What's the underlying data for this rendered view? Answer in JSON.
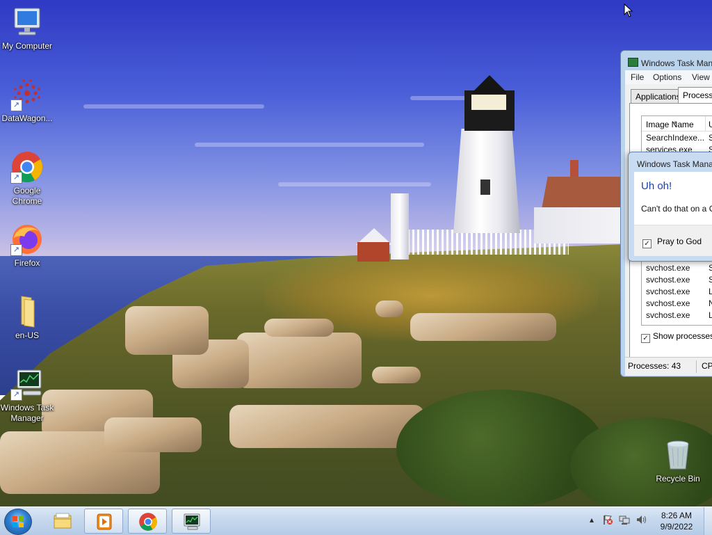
{
  "desktop": {
    "icons": [
      {
        "label": "My Computer",
        "icon": "computer-icon"
      },
      {
        "label": "DataWagon...",
        "icon": "datawagon-icon"
      },
      {
        "label": "Google Chrome",
        "icon": "chrome-icon"
      },
      {
        "label": "Firefox",
        "icon": "firefox-icon"
      },
      {
        "label": "en-US",
        "icon": "folder-icon"
      },
      {
        "label": "Windows Task Manager",
        "icon": "task-manager-icon"
      },
      {
        "label": "Recycle Bin",
        "icon": "recycle-bin-icon"
      }
    ]
  },
  "task_manager": {
    "title": "Windows Task Man",
    "menu": [
      "File",
      "Options",
      "View"
    ],
    "tabs": [
      "Applications",
      "Processe"
    ],
    "columns": [
      "Image Name",
      "U"
    ],
    "rows_top": [
      {
        "name": "SearchIndexe...",
        "user": "S"
      },
      {
        "name": "services.exe",
        "user": "S"
      }
    ],
    "rows_bottom": [
      {
        "name": "svchost.exe",
        "user": "S"
      },
      {
        "name": "svchost.exe",
        "user": "S"
      },
      {
        "name": "svchost.exe",
        "user": "L"
      },
      {
        "name": "svchost.exe",
        "user": "N"
      },
      {
        "name": "svchost.exe",
        "user": "L"
      }
    ],
    "show_processes_label": "Show processes f",
    "show_processes_checked": true,
    "status": {
      "processes": "Processes: 43",
      "cpu": "CP"
    }
  },
  "dialog": {
    "title": "Windows Task Mana",
    "main_instruction": "Uh oh!",
    "message": "Can't do that on a C",
    "checkbox_label": "Pray to God",
    "checkbox_checked": true
  },
  "taskbar": {
    "start_icon": "windows-start-icon",
    "buttons": [
      {
        "icon": "explorer-folder-icon",
        "state": "pinned"
      },
      {
        "icon": "media-player-icon",
        "state": "open"
      },
      {
        "icon": "chrome-icon",
        "state": "open"
      },
      {
        "icon": "task-manager-icon",
        "state": "open"
      }
    ],
    "tray": [
      "show-hidden-icons-arrow",
      "action-center-flag-icon",
      "network-icon",
      "volume-icon"
    ],
    "time": "8:26 AM",
    "date": "9/9/2022"
  },
  "colors": {
    "taskbar": "#c6d8ee",
    "dialog_heading": "#1c3fa8",
    "window_frame": "#bcd3ec"
  }
}
